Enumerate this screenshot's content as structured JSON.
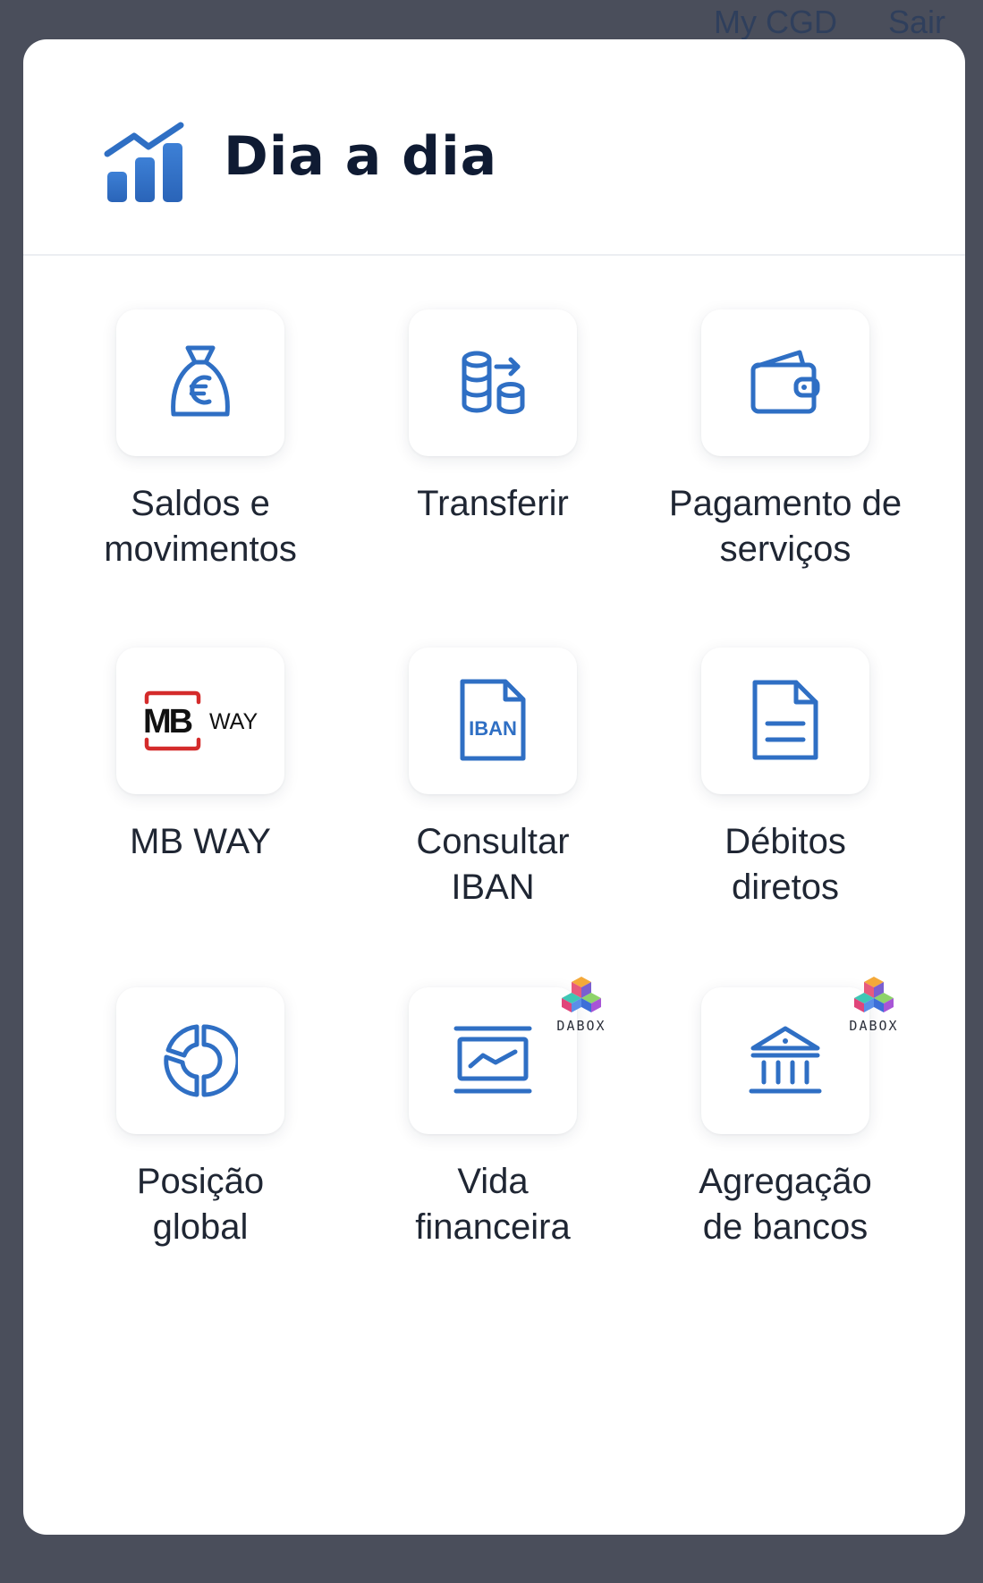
{
  "topbar": {
    "my_cgd": "My CGD",
    "sair": "Sair"
  },
  "modal": {
    "title": "Dia a dia"
  },
  "tiles": [
    {
      "line1": "Saldos e",
      "line2": "movimentos",
      "icon": "money-bag-euro-icon"
    },
    {
      "line1": "Transferir",
      "line2": "",
      "icon": "coins-transfer-icon"
    },
    {
      "line1": "Pagamento de",
      "line2": "serviços",
      "icon": "wallet-icon"
    },
    {
      "line1": "MB WAY",
      "line2": "",
      "icon": "mbway-logo"
    },
    {
      "line1": "Consultar",
      "line2": "IBAN",
      "icon": "iban-document-icon"
    },
    {
      "line1": "Débitos",
      "line2": "diretos",
      "icon": "document-icon"
    },
    {
      "line1": "Posição",
      "line2": "global",
      "icon": "donut-chart-icon"
    },
    {
      "line1": "Vida",
      "line2": "financeira",
      "icon": "monitor-chart-icon"
    },
    {
      "line1": "Agregação",
      "line2": "de bancos",
      "icon": "bank-icon"
    }
  ],
  "icons": {
    "mbway": {
      "mb": "MB",
      "way": "WAY"
    },
    "iban": "IBAN",
    "dabox": "DABOX"
  },
  "colors": {
    "primary": "#2f6fc4",
    "title": "#0f1b33",
    "mbway_red": "#d42b2b",
    "backdrop": "#4a4e5b"
  }
}
